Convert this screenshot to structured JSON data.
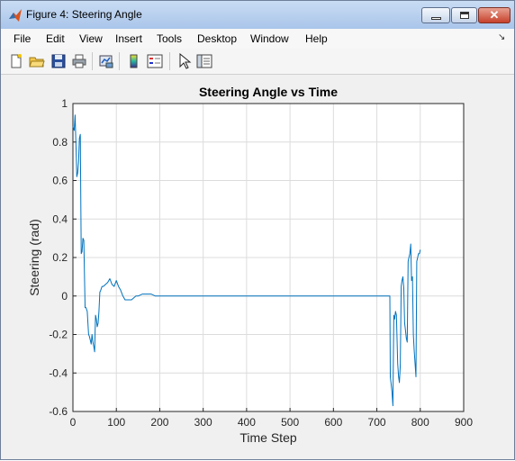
{
  "window": {
    "title": "Figure 4: Steering Angle",
    "minimize_icon": "minimize-icon",
    "maximize_icon": "maximize-icon",
    "close_icon": "close-icon",
    "close_glyph": "✕"
  },
  "menu": {
    "items": [
      "File",
      "Edit",
      "View",
      "Insert",
      "Tools",
      "Desktop",
      "Window",
      "Help"
    ],
    "dock_arrow": "↘"
  },
  "toolbar": {
    "icons": [
      "new-figure-icon",
      "open-file-icon",
      "save-icon",
      "print-icon",
      "link-plot-icon",
      "colorbar-icon",
      "legend-icon",
      "edit-plot-pointer-icon",
      "property-inspector-icon"
    ]
  },
  "colors": {
    "line": "#0072bd",
    "grid": "#dcdcdc",
    "axes_bg": "#ffffff",
    "figure_bg": "#f0f0f0"
  },
  "chart_data": {
    "type": "line",
    "title": "Steering Angle vs Time",
    "xlabel": "Time Step",
    "ylabel": "Steering (rad)",
    "xlim": [
      0,
      900
    ],
    "ylim": [
      -0.6,
      1
    ],
    "grid": true,
    "xticks": [
      0,
      100,
      200,
      300,
      400,
      500,
      600,
      700,
      800,
      900
    ],
    "yticks": [
      -0.6,
      -0.4,
      -0.2,
      0,
      0.2,
      0.4,
      0.6,
      0.8,
      1
    ],
    "xtick_labels": [
      "0",
      "100",
      "200",
      "300",
      "400",
      "500",
      "600",
      "700",
      "800",
      "900"
    ],
    "ytick_labels": [
      "-0.6",
      "-0.4",
      "-0.2",
      "0",
      "0.2",
      "0.4",
      "0.6",
      "0.8",
      "1"
    ],
    "series": [
      {
        "x": [
          0,
          3,
          5,
          7,
          9,
          11,
          13,
          15,
          17,
          19,
          21,
          23,
          25,
          28,
          30,
          33,
          36,
          38,
          40,
          42,
          44,
          46,
          48,
          50,
          52,
          54,
          56,
          58,
          60,
          62,
          64,
          67,
          70,
          75,
          80,
          85,
          90,
          95,
          100,
          105,
          110,
          115,
          120,
          125,
          130,
          135,
          140,
          145,
          150,
          160,
          170,
          180,
          190,
          200,
          250,
          300,
          400,
          500,
          600,
          700,
          730,
          731,
          733,
          735,
          737,
          739,
          741,
          743,
          745,
          748,
          750,
          752,
          754,
          756,
          758,
          760,
          762,
          764,
          766,
          768,
          770,
          772,
          774,
          776,
          778,
          780,
          782,
          784,
          786,
          788,
          790,
          792,
          794,
          796,
          798,
          800
        ],
        "y": [
          0.88,
          0.86,
          0.94,
          0.78,
          0.62,
          0.64,
          0.7,
          0.82,
          0.84,
          0.22,
          0.23,
          0.3,
          0.29,
          -0.06,
          -0.06,
          -0.08,
          -0.2,
          -0.21,
          -0.23,
          -0.25,
          -0.2,
          -0.24,
          -0.26,
          -0.29,
          -0.1,
          -0.12,
          -0.16,
          -0.14,
          -0.08,
          0.02,
          0.03,
          0.05,
          0.05,
          0.06,
          0.07,
          0.09,
          0.06,
          0.05,
          0.08,
          0.05,
          0.03,
          0.0,
          -0.02,
          -0.02,
          -0.02,
          -0.02,
          -0.01,
          0.0,
          0.0,
          0.01,
          0.01,
          0.01,
          0.0,
          0.0,
          0.0,
          0.0,
          0.0,
          0.0,
          0.0,
          0.0,
          0.0,
          -0.42,
          -0.46,
          -0.5,
          -0.57,
          -0.1,
          -0.12,
          -0.08,
          -0.1,
          -0.35,
          -0.42,
          -0.45,
          -0.36,
          0.05,
          0.08,
          0.1,
          0.04,
          -0.14,
          -0.18,
          -0.22,
          -0.24,
          0.18,
          0.2,
          0.22,
          0.27,
          0.08,
          0.1,
          -0.2,
          -0.28,
          -0.35,
          -0.42,
          0.18,
          0.2,
          0.22,
          0.22,
          0.24
        ]
      }
    ]
  }
}
